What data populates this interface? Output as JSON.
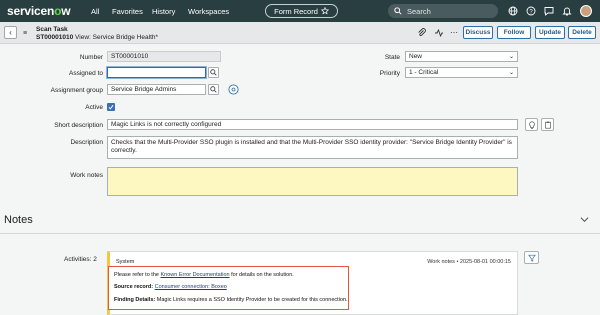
{
  "nav": {
    "logo_text_a": "servicen",
    "logo_text_o": "o",
    "logo_text_b": "w",
    "items": [
      "All",
      "Favorites",
      "History",
      "Workspaces"
    ],
    "form_record": "Form Record",
    "search_placeholder": "Search"
  },
  "header": {
    "title": "Scan Task",
    "number": "ST00001010",
    "view_label": "View: Service Bridge Health*",
    "buttons": [
      "Discuss",
      "Follow",
      "Update",
      "Delete"
    ]
  },
  "form": {
    "number_label": "Number",
    "number_value": "ST00001010",
    "assigned_to_label": "Assigned to",
    "assigned_to_value": "",
    "assignment_group_label": "Assignment group",
    "assignment_group_value": "Service Bridge Admins",
    "active_label": "Active",
    "active_checked": true,
    "state_label": "State",
    "state_value": "New",
    "priority_label": "Priority",
    "priority_value": "1 - Critical",
    "short_desc_label": "Short description",
    "short_desc_value": "Magic Links is not correctly configured",
    "desc_label": "Description",
    "desc_line1": "Checks that the Multi-Provider SSO plugin is installed and  that the Multi-Provider SSO identity provider: \"Service Bridge Identity Provider\" is setup",
    "desc_line2": "correctly.",
    "work_notes_label": "Work notes"
  },
  "notes": {
    "title": "Notes",
    "activities_label": "Activities: 2",
    "entry": {
      "author": "System",
      "meta": "Work notes  • 2025-08-01 00:00:15",
      "line1_pre": "Please refer to the ",
      "line1_link": "Known Error Documentation",
      "line1_post": " for details on the solution.",
      "line2_label": "Source record:",
      "line2_link": "Consumer connection: Boxeo",
      "line3_label": "Finding Details:",
      "line3_text": " Magic Links requires a SSO Identity Provider to be created for this connection."
    }
  },
  "colors": {
    "nav_bg": "#293e40",
    "accent": "#62d84e",
    "highlight": "#e2583d",
    "worknotes_bg": "#fdf7c2"
  }
}
